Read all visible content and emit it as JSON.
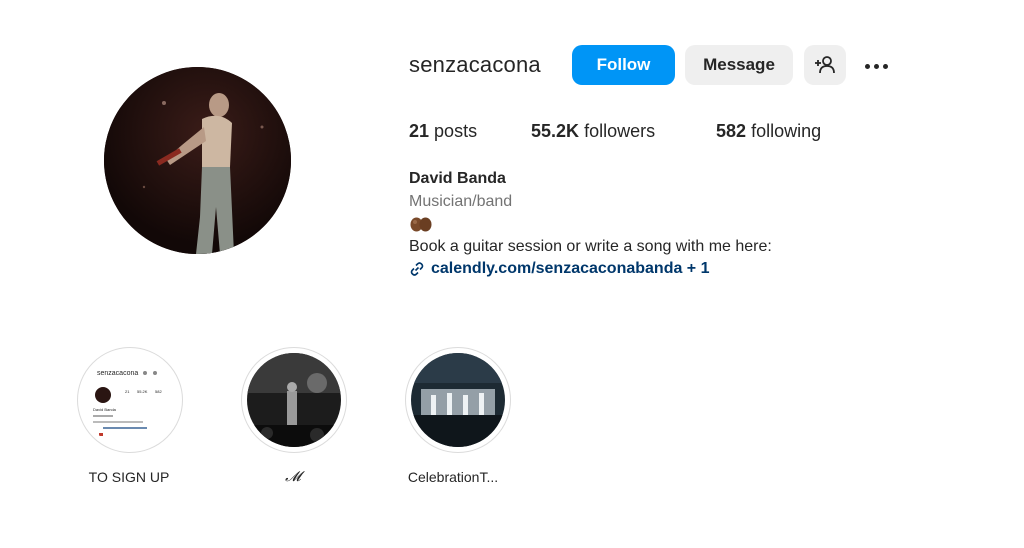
{
  "profile": {
    "username": "senzacacona",
    "follow_label": "Follow",
    "message_label": "Message",
    "add_user_icon": "add-user-icon",
    "more_icon": "more-options-icon",
    "stats": {
      "posts_count": "21",
      "posts_label": "posts",
      "followers_count": "55.2K",
      "followers_label": "followers",
      "following_count": "582",
      "following_label": "following"
    },
    "full_name": "David Banda",
    "category": "Musician/band",
    "bio": "Book a guitar session or write a song with me here:",
    "link_text": "calendly.com/senzacaconabanda + 1",
    "link_icon": "link-icon"
  },
  "highlights": [
    {
      "label": "TO SIGN UP"
    },
    {
      "label": "𝓜"
    },
    {
      "label": "CelebrationT..."
    }
  ],
  "thumbnail_1": {
    "username": "senzacacona",
    "posts": "21",
    "followers": "55.2K",
    "following": "582",
    "name": "David Banda"
  },
  "colors": {
    "follow_button": "#0095f6",
    "secondary_button": "#efefef",
    "link": "#00376b"
  }
}
